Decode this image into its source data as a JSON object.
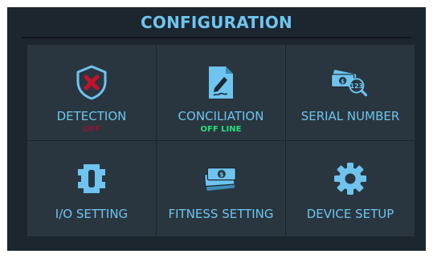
{
  "header": {
    "title": "CONFIGURATION"
  },
  "tiles": [
    {
      "label": "DETECTION",
      "status": "OFF",
      "status_color": "#8b1538"
    },
    {
      "label": "CONCILIATION",
      "status": "OFF LINE",
      "status_color": "#27e07a"
    },
    {
      "label": "SERIAL NUMBER"
    },
    {
      "label": "I/O SETTING"
    },
    {
      "label": "FITNESS SETTING"
    },
    {
      "label": "DEVICE SETUP"
    }
  ],
  "colors": {
    "accent": "#6ec4ef",
    "background": "#1c262e",
    "tile": "#2a363f",
    "alert": "#c8102e"
  },
  "icons": [
    "shield-x-icon",
    "document-signature-icon",
    "banknote-serial-search-icon",
    "io-connector-icon",
    "banknotes-stack-icon",
    "gear-icon"
  ]
}
